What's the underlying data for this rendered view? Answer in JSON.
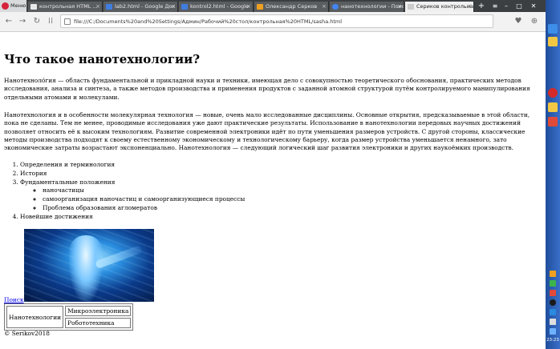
{
  "browser": {
    "menu_label": "Меню",
    "tabs": [
      {
        "label": "контрольная HTML ...",
        "color": "#e8e8e8"
      },
      {
        "label": "lab2.html - Google Док",
        "color": "#3f7de0"
      },
      {
        "label": "kontrol2.html - Google",
        "color": "#3f7de0"
      },
      {
        "label": "Олександр Серков",
        "color": "#f0a020"
      },
      {
        "label": "нанотехнологии - Поиск",
        "color": "#4285f4"
      },
      {
        "label": "Сериков контрольная",
        "color": "#cccccc",
        "active": true
      }
    ],
    "new_tab": "+",
    "url": "file:///C:/Documents%20and%20Settings/Админ/Рабочий%20стол/контрольная%20HTML/sasha.html"
  },
  "page": {
    "title": "Что такое нанотехнологии?",
    "paragraph1": "Нанотехноло́гия — область фундаментальной и прикладной науки и техники, имеющая дело с совокупностью теоретического обоснования, практических методов исследования, анализа и синтеза, а также методов производства и применения продуктов с заданной атомной структурой путём контролируемого манипулирования отдельными атомами и молекулами.",
    "paragraph2": "Нанотехнология и в особенности молекулярная технология — новые, очень мало исследованные дисциплины. Основные открытия, предсказываемые в этой области, пока не сделаны. Тем не менее, проводимые исследования уже дают практические результаты. Использование в нанотехнологии передовых научных достижений позволяет относить её к высоким технологиям. Развитие современной электроники идёт по пути уменьшения размеров устройств. С другой стороны, классические методы производства подходят к своему естественному экономическому и технологическому барьеру, когда размер устройства уменьшается ненамного, зато экономические затраты возрастают экспоненциально. Нанотехнология — следующий логический шаг развития электроники и других наукоёмких производств.",
    "list": {
      "item1": "Определения и терминология",
      "item2": "История",
      "item3": "Фундаментальные положения",
      "sub1": "наночастицы",
      "sub2": "самоорганизация наночастиц и самоорганизующиеся процессы",
      "sub3": "Проблема образования агломератов",
      "item4": "Новейшие достижения"
    },
    "search_link": "Поиск",
    "table": {
      "left": "Нанотехнологии",
      "right1": "Микроэлектроника",
      "right2": "Робототехника"
    },
    "footer": "© Serikov2018"
  },
  "taskbar": {
    "clock": "23:23"
  }
}
